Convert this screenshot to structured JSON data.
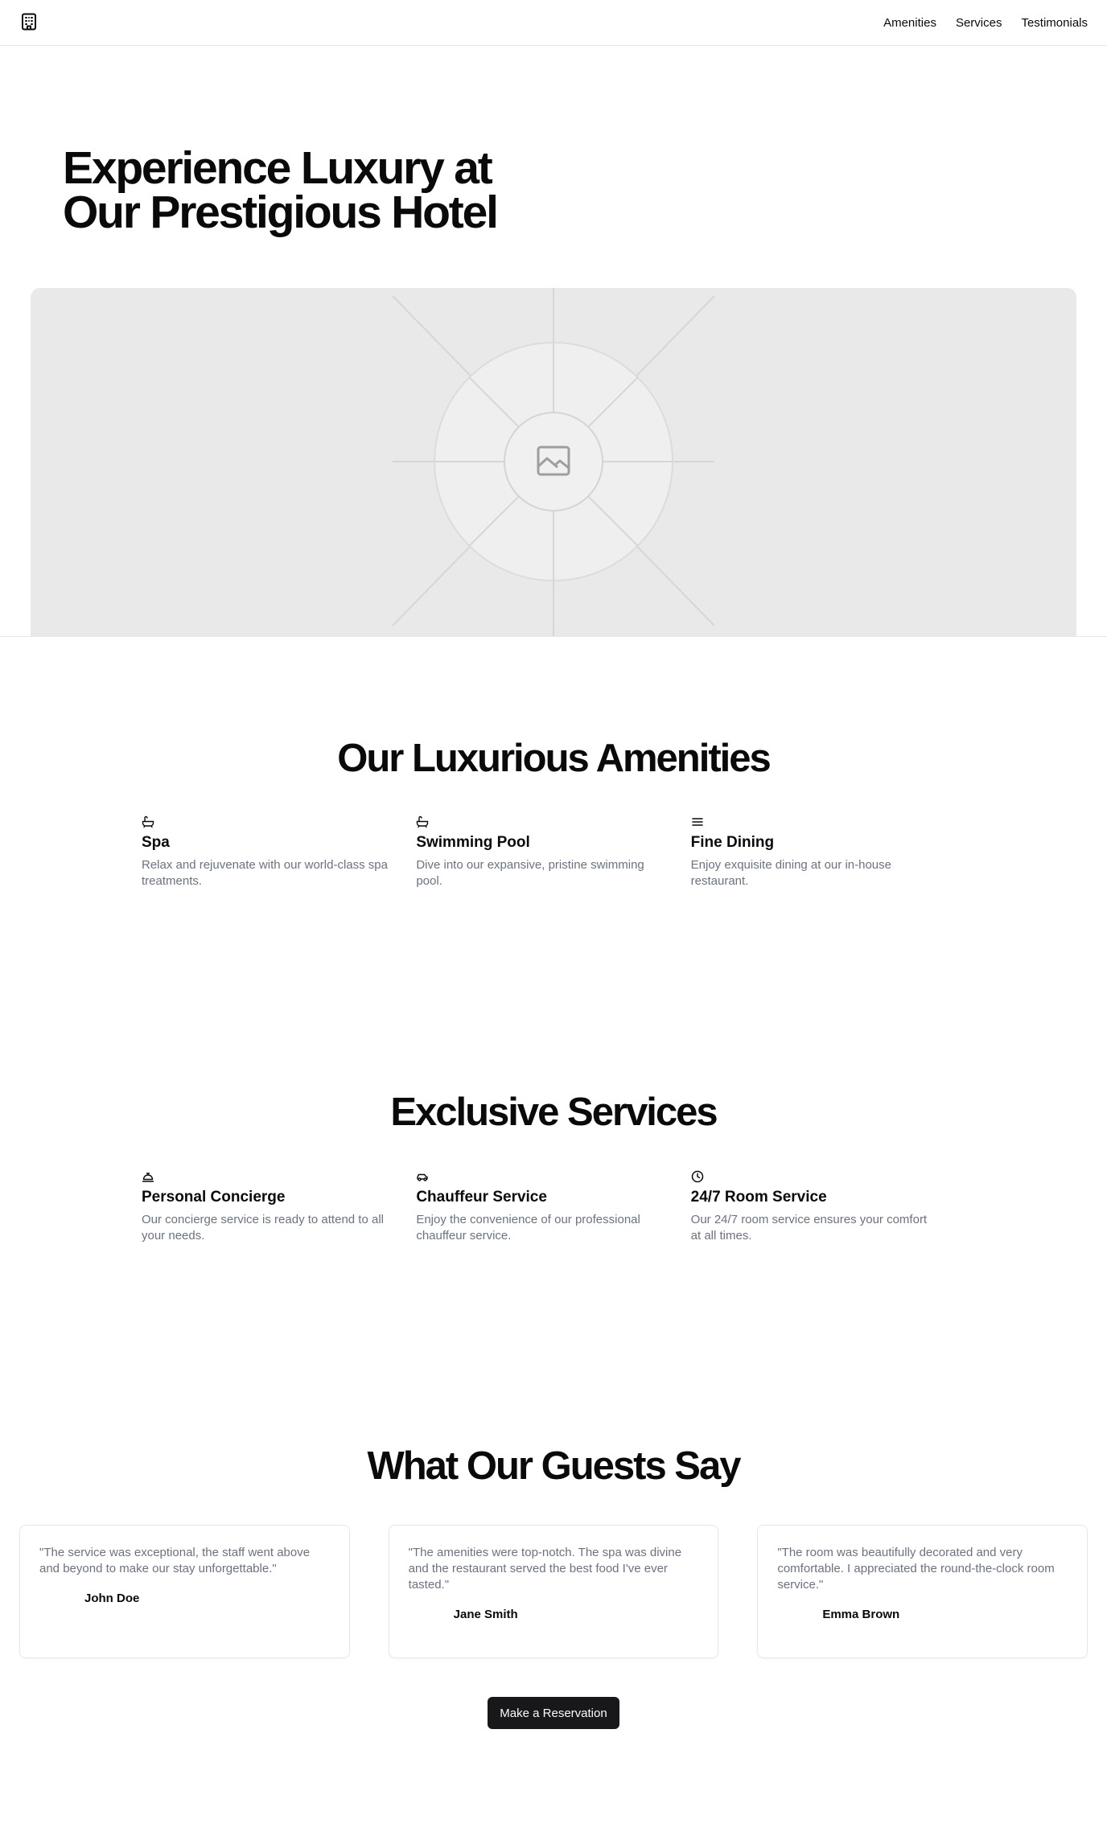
{
  "header": {
    "logo_icon": "hotel-building-icon",
    "nav": [
      {
        "label": "Amenities"
      },
      {
        "label": "Services"
      },
      {
        "label": "Testimonials"
      }
    ]
  },
  "hero": {
    "title_line1": "Experience Luxury at",
    "title_line2": "Our Prestigious Hotel",
    "image_icon": "image-placeholder-icon"
  },
  "amenities": {
    "title": "Our Luxurious Amenities",
    "items": [
      {
        "icon": "bath-icon",
        "title": "Spa",
        "description": "Relax and rejuvenate with our world-class spa treatments."
      },
      {
        "icon": "bath-icon",
        "title": "Swimming Pool",
        "description": "Dive into our expansive, pristine swimming pool."
      },
      {
        "icon": "menu-icon",
        "title": "Fine Dining",
        "description": "Enjoy exquisite dining at our in-house restaurant."
      }
    ]
  },
  "services": {
    "title": "Exclusive Services",
    "items": [
      {
        "icon": "concierge-bell-icon",
        "title": "Personal Concierge",
        "description": "Our concierge service is ready to attend to all your needs."
      },
      {
        "icon": "car-icon",
        "title": "Chauffeur Service",
        "description": "Enjoy the convenience of our professional chauffeur service."
      },
      {
        "icon": "clock-icon",
        "title": "24/7 Room Service",
        "description": "Our 24/7 room service ensures your comfort at all times."
      }
    ]
  },
  "testimonials": {
    "title": "What Our Guests Say",
    "items": [
      {
        "quote": "\"The service was exceptional, the staff went above and beyond to make our stay unforgettable.\"",
        "author": "John Doe"
      },
      {
        "quote": "\"The amenities were top-notch. The spa was divine and the restaurant served the best food I've ever tasted.\"",
        "author": "Jane Smith"
      },
      {
        "quote": "\"The room was beautifully decorated and very comfortable. I appreciated the round-the-clock room service.\"",
        "author": "Emma Brown"
      }
    ]
  },
  "cta": {
    "label": "Make a Reservation"
  }
}
